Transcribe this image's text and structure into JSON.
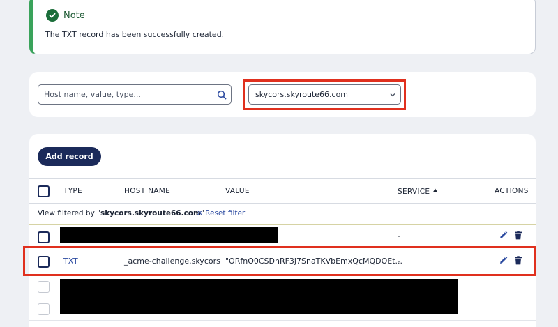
{
  "note": {
    "title": "Note",
    "message": "The TXT record has been successfully created."
  },
  "filter": {
    "search_placeholder": "Host name, value, type...",
    "selected_domain": "skycors.skyroute66.com"
  },
  "records": {
    "add_label": "Add record",
    "columns": {
      "type": "TYPE",
      "host": "HOST NAME",
      "value": "VALUE",
      "service": "SERVICE",
      "actions": "ACTIONS"
    },
    "filter_prefix": "View filtered by \"",
    "filter_domain": "skycors.skyroute66.com",
    "filter_suffix": "\"",
    "reset_label": "Reset filter",
    "rows": [
      {
        "service": "-"
      },
      {
        "type": "TXT",
        "host": "_acme-challenge.skycors",
        "value": "\"ORfnO0CSDnRF3j7SnaTKVbEmxQcMQDOEt...",
        "service": "-"
      }
    ]
  },
  "colors": {
    "success": "#3aa35b",
    "primary": "#1b2a5a",
    "link": "#2b4aa0",
    "highlight": "#e0301e"
  }
}
